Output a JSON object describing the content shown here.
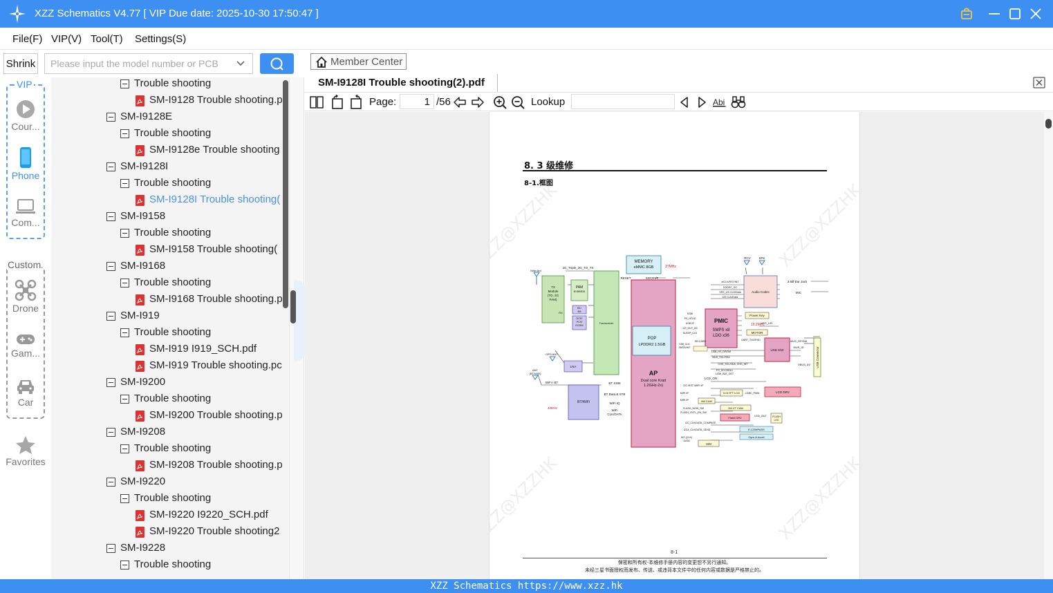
{
  "app": {
    "title": "XZZ Schematics V4.77 [ VIP Due date: 2025-10-30 17:50:47 ]"
  },
  "menu": [
    "File(F)",
    "VIP(V)",
    "Tool(T)",
    "Settings(S)"
  ],
  "search": {
    "shrink_label": "Shrink",
    "placeholder": "Please input the model number or PCB"
  },
  "rail": {
    "vip_label": "VIP",
    "custom_label": "Custom",
    "vip_items": [
      {
        "label": "Cour...",
        "icon": "play-circle-icon"
      },
      {
        "label": "Phone",
        "icon": "phone-icon"
      },
      {
        "label": "Com...",
        "icon": "laptop-icon"
      }
    ],
    "custom_items": [
      {
        "label": "Drone",
        "icon": "drone-icon"
      },
      {
        "label": "Gam...",
        "icon": "gamepad-icon"
      },
      {
        "label": "Car",
        "icon": "car-icon"
      }
    ],
    "favorites_label": "Favorites"
  },
  "tree": [
    {
      "level": 2,
      "type": "folder",
      "label": "Trouble shooting"
    },
    {
      "level": 3,
      "type": "file",
      "label": "SM-I9128 Trouble shooting.p"
    },
    {
      "level": 1,
      "type": "folder",
      "label": "SM-I9128E"
    },
    {
      "level": 2,
      "type": "folder",
      "label": "Trouble shooting"
    },
    {
      "level": 3,
      "type": "file",
      "label": "SM-I9128e Trouble shooting"
    },
    {
      "level": 1,
      "type": "folder",
      "label": "SM-I9128I"
    },
    {
      "level": 2,
      "type": "folder",
      "label": "Trouble shooting"
    },
    {
      "level": 3,
      "type": "file",
      "label": "SM-I9128I Trouble shooting(",
      "selected": true
    },
    {
      "level": 1,
      "type": "folder",
      "label": "SM-I9158"
    },
    {
      "level": 2,
      "type": "folder",
      "label": "Trouble shooting"
    },
    {
      "level": 3,
      "type": "file",
      "label": "SM-I9158 Trouble shooting("
    },
    {
      "level": 1,
      "type": "folder",
      "label": "SM-I9168"
    },
    {
      "level": 2,
      "type": "folder",
      "label": "Trouble shooting"
    },
    {
      "level": 3,
      "type": "file",
      "label": "SM-I9168 Trouble shooting.p"
    },
    {
      "level": 1,
      "type": "folder",
      "label": "SM-I919"
    },
    {
      "level": 2,
      "type": "folder",
      "label": "Trouble shooting"
    },
    {
      "level": 3,
      "type": "file",
      "label": "SM-I919 I919_SCH.pdf"
    },
    {
      "level": 3,
      "type": "file",
      "label": "SM-I919 Trouble shooting.pc"
    },
    {
      "level": 1,
      "type": "folder",
      "label": "SM-I9200"
    },
    {
      "level": 2,
      "type": "folder",
      "label": "Trouble shooting"
    },
    {
      "level": 3,
      "type": "file",
      "label": "SM-I9200 Trouble shooting.p"
    },
    {
      "level": 1,
      "type": "folder",
      "label": "SM-I9208"
    },
    {
      "level": 2,
      "type": "folder",
      "label": "Trouble shooting"
    },
    {
      "level": 3,
      "type": "file",
      "label": "SM-I9208 Trouble shooting.p"
    },
    {
      "level": 1,
      "type": "folder",
      "label": "SM-I9220"
    },
    {
      "level": 2,
      "type": "folder",
      "label": "Trouble shooting"
    },
    {
      "level": 3,
      "type": "file",
      "label": "SM-I9220 I9220_SCH.pdf"
    },
    {
      "level": 3,
      "type": "file",
      "label": "SM-I9220 Trouble shooting2"
    },
    {
      "level": 1,
      "type": "folder",
      "label": "SM-I9228"
    },
    {
      "level": 2,
      "type": "folder",
      "label": "Trouble shooting"
    }
  ],
  "viewer": {
    "member_center": "Member Center",
    "doc_title": "SM-I9128I Trouble shooting(2).pdf",
    "page_label": "Page:",
    "page_current": "1",
    "page_total": "/56",
    "lookup_label": "Lookup",
    "lookup_value": ""
  },
  "document": {
    "heading": "8. 3 级维修",
    "subheading": "8-1.框图",
    "watermark": "XZZ@XZZHK",
    "page_number": "8-1",
    "footer_line1": "保密和所有权-本维修手册内容的变更恕不另行通知。",
    "footer_line2": "未经三星书面授权而发布、传送、或违背本文件中的任何内容或数据是严格禁止的。",
    "diagram": {
      "memory": "MEMORY",
      "emmc": "eMMC  8GB",
      "clk27": "27MHz",
      "main_ant": "Main Ant",
      "tx_module": [
        "TX",
        "Module",
        "(TD, 2G",
        "PAM)"
      ],
      "rx": "RX",
      "pam": "PAM",
      "pam_bands": "B1/B8/B34",
      "b1b8": [
        "B1/",
        "B8"
      ],
      "dcs": [
        "DCS/",
        "PCS/",
        "EGSM"
      ],
      "transceiver": "Transceiver",
      "line_2g": "2G_Triple_3G_TO_TX",
      "reset": "RESET",
      "sdc1": "SDC1 I/F",
      "pop": "POP",
      "lpddr": "LPDDR2 1.5GB",
      "ap": "AP",
      "ap_sub1": "Dual core Krait",
      "ap_sub2": "1.2GHz-2x)",
      "pmic": "PMIC",
      "smps": "SMPS x8",
      "ldo": "LDO x36",
      "clk192": "19.2MHz",
      "power_key": "Power Key",
      "motor": "MOTOR",
      "audio": "Audio Codec",
      "rcv": "RCV",
      "spk": "SPK",
      "ear_jack": "3.5Ø Ear Jack",
      "mic": "MIC",
      "usb_sw": "USB S/W",
      "usb_conn": "USB Connector",
      "vfs": "VFS_L/R",
      "mus_dp": "MUS_DP/DM",
      "mus_id": "MUS_ID",
      "vbus": "VBUS_5V",
      "gps_ant": "GPS ANT",
      "lna": "LNA",
      "ant_bt": [
        "ANT",
        "(BT/WiFi)"
      ],
      "wifi_bt": "WiFi / BT",
      "bt_wifi": "BT/WiFi",
      "clk48": "48MHz",
      "bt_ssbi": "BT SSBI",
      "bt_data": "BT Data & STB",
      "wifi_iq": "WiFi IQ",
      "wifi_clk": [
        "WiFi",
        "CLK/DATA"
      ],
      "lcd_on": "LCD_ON",
      "lcd_size": "5.01TFT LCD",
      "lcd_drv": "LCD DRV",
      "cam8": "8M CAM",
      "cam2": "2M VT CAM",
      "flash_drv": "Flash DRV",
      "flash_led": [
        "FLASH",
        "LED"
      ],
      "led_out": "LED_OUT",
      "compass": "E-COMPASS",
      "gyro": "Gyro & Accel",
      "sim": "SIM",
      "mclk": "MCLK/RST/INT",
      "codec_i2c": "CODEC_I2C",
      "spk_i2s": "SPK_I2S CLK/Data",
      "i2s": "I2S CLK/Data",
      "ssbi": "SSBI",
      "ps_hold": "PS_HOLD",
      "usb_if": "USB I/F",
      "xo_out": "XO_OUT_D0",
      "sleep_clk": "SLEEP_CLK",
      "uart": "UART_TXD/RXD",
      "usb_hs": "USB_HS_DP/DM",
      "mus_scl": "MUS_SCL/SDA",
      "chg_scl": "CHG_SCL/SDA, CHG_INT",
      "fg_scl": "FG_SCL/SDA /",
      "low_bat": "LOW_BAT_DET",
      "i2c_rst": "I2C /RST /MIPI I/F",
      "mipi1": "MIPI I/F",
      "mipi2": "MIPI I/F",
      "flash_now": "FLASH_NOW_SW",
      "flash_cntl": "FLASH_CNTL_EN_SW",
      "i2c_compass": "I2C_CLK/DATA_COMPASS",
      "i2c_sens": "I2C4_CLK/DATA_SENS",
      "int_clk": [
        "INT (CLK)",
        "DATA"
      ],
      "cabc": "CABC_PWM",
      "hdmi": [
        "SIM_CLK",
        "/DATA/INT"
      ],
      "sd_card": "SD CARD"
    }
  },
  "status": {
    "text": "XZZ Schematics https://www.xzz.hk"
  },
  "colors": {
    "brand_blue": "#3d8ff2",
    "selected_text": "#4a90e2",
    "pdf_red": "#d93434",
    "ap_fill": "#e3a5c3",
    "transceiver_fill": "#c2e7b6",
    "memory_fill": "#d7f1f5"
  }
}
